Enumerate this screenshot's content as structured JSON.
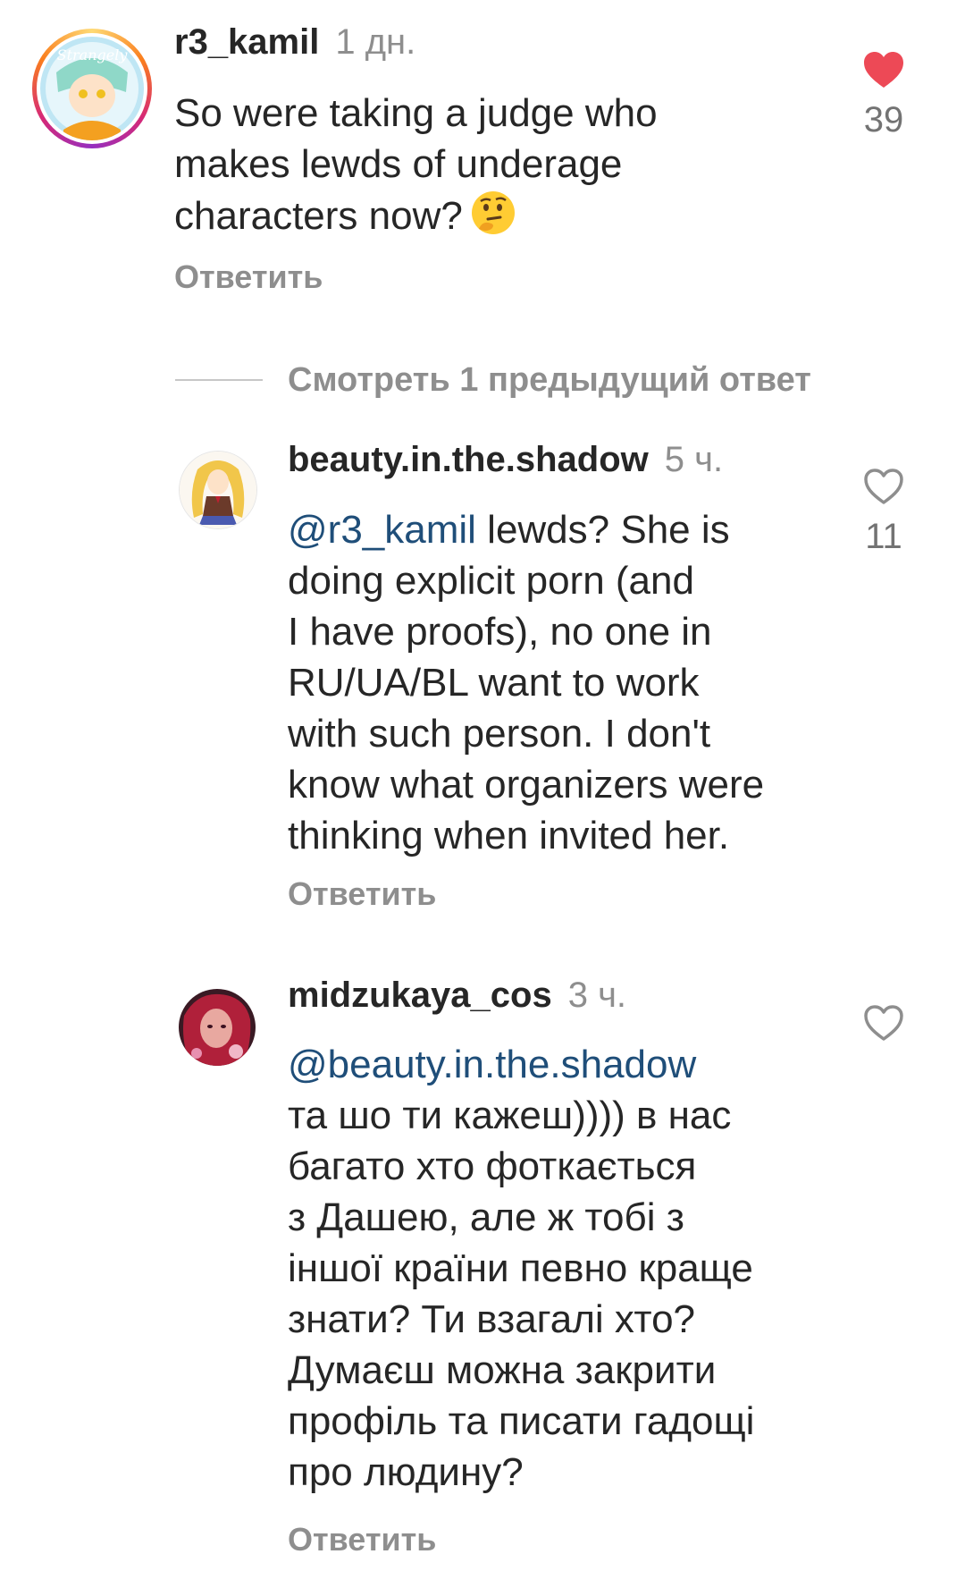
{
  "comments": [
    {
      "username": "r3_kamil",
      "time": "1 дн.",
      "text_lines": [
        "So were taking a judge who",
        "makes lewds of underage",
        "characters now?"
      ],
      "emoji": "thinking-face",
      "reply_label": "Ответить",
      "likes": "39",
      "liked": true
    },
    {
      "username": "beauty.in.the.shadow",
      "time": "5 ч.",
      "mention": "@r3_kamil",
      "text_first": " lewds? She is",
      "text_lines": [
        "doing explicit porn (and",
        "I have proofs), no one in",
        "RU/UA/BL want to work",
        "with such person. I don't",
        "know what organizers were",
        "thinking when invited her."
      ],
      "reply_label": "Ответить",
      "likes": "11",
      "liked": false
    },
    {
      "username": "midzukaya_cos",
      "time": "3 ч.",
      "mention": "@beauty.in.the.shadow",
      "text_lines": [
        "та шо ти кажеш)))) в нас",
        "багато хто фоткається",
        "з Дашею, але ж тобі з",
        "іншої країни певно краще",
        "знати? Ти взагалі хто?",
        "Думаєш можна закрити",
        "профіль та писати гадощі",
        "про людину?"
      ],
      "reply_label": "Ответить",
      "likes": "",
      "liked": false
    }
  ],
  "view_replies_label": "Смотреть 1 предыдущий ответ",
  "colors": {
    "heart_active": "#ed4956",
    "mention": "#1f4e79",
    "secondary_text": "#8e8e8e",
    "primary_text": "#262626"
  },
  "icons": {
    "like_filled": "heart-filled-icon",
    "like_outline": "heart-outline-icon",
    "emoji": "thinking-face-emoji"
  }
}
